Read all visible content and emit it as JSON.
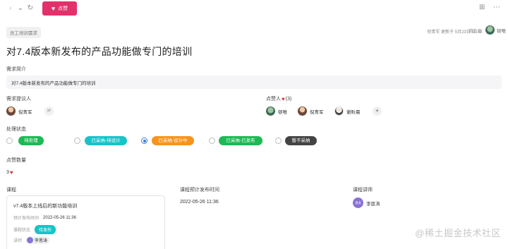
{
  "toolbar": {
    "back_glyph": "‹",
    "dropdown_glyph": "⌄",
    "refresh_glyph": "↻",
    "like_label": "点赞",
    "accent": "#e3306b",
    "settings_glyph": "⊞",
    "more_glyph": "⋯"
  },
  "header": {
    "tag": "员工培训需求",
    "meta": "倪青军 更新于 5月23日 11:30",
    "owner_label": "拥有者:",
    "owner_name": "顿唯"
  },
  "title": "对7.4版本新发布的产品功能做专门的培训",
  "intro": {
    "label": "需求简介",
    "text": "对7.4版本新发布的产品功能做专门的培训"
  },
  "proposer": {
    "label": "需求提议人",
    "name": "倪青军"
  },
  "likers": {
    "label": "点赞人",
    "count_text": "(3)",
    "people": [
      "顿唯",
      "倪青军",
      "谢昕晨"
    ]
  },
  "status": {
    "label": "处理状态",
    "options": [
      {
        "label": "待处理",
        "color": "#1db954",
        "selected": false
      },
      {
        "label": "已采纳-待设计",
        "color": "#17c3c8",
        "selected": false
      },
      {
        "label": "已采纳-设计中",
        "color": "#f7941d",
        "selected": true
      },
      {
        "label": "已采纳-已发布",
        "color": "#1db954",
        "selected": false
      },
      {
        "label": "暂不采纳",
        "color": "#444444",
        "selected": false
      }
    ]
  },
  "like_count": {
    "label": "点赞数量",
    "value": "3"
  },
  "course": {
    "label": "课程",
    "card_title": "v7.4版本上线后的新功能培训",
    "publish_label": "预计发布时间",
    "publish_value": "2022-05-26 11:36",
    "status_label": "课程状态",
    "status_value": "待发布",
    "teacher_label": "讲师",
    "teacher_name": "李恩涛"
  },
  "course_publish": {
    "label": "课程预计发布时间",
    "value": "2022-05-26 11:36"
  },
  "course_teacher": {
    "label": "课程讲师",
    "name": "李恩涛",
    "avatar_text": "恩涛"
  },
  "watermark": "@稀土掘金技术社区"
}
